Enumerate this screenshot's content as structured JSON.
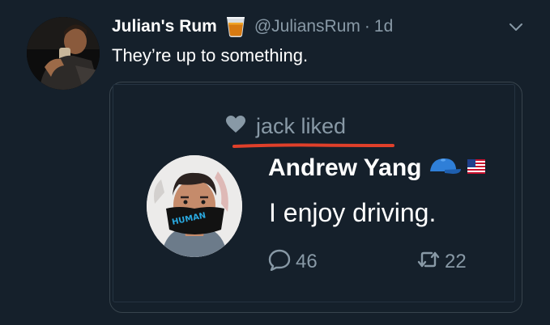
{
  "tweet": {
    "display_name": "Julian's Rum",
    "name_emoji": "rum-glass-emoji",
    "handle": "@JuliansRum",
    "separator": "·",
    "time": "1d",
    "text": "They’re up to something.",
    "menu_icon": "chevron-down-icon"
  },
  "embedded": {
    "liked_icon": "heart-icon",
    "liked_text": "jack liked",
    "author_name": "Andrew Yang",
    "author_emojis": [
      "blue-cap-emoji",
      "us-flag-emoji"
    ],
    "text": "I enjoy driving.",
    "mask_text": "HUMAN",
    "reply_icon": "reply-icon",
    "reply_count": "46",
    "retweet_icon": "retweet-icon",
    "retweet_count": "22"
  },
  "colors": {
    "background": "#15202b",
    "secondary_text": "#8899a6",
    "border": "#38444d",
    "underline": "#e0402a"
  }
}
